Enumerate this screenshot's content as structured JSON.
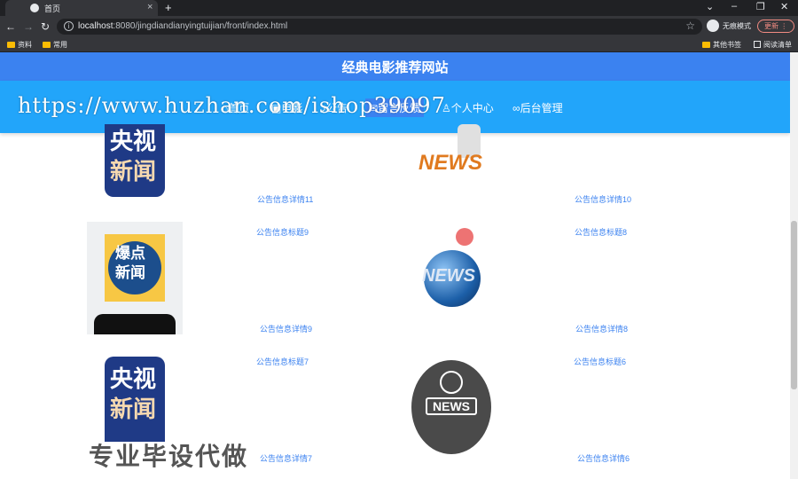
{
  "browser": {
    "tab_title": "首页",
    "new_tab": "+",
    "window_controls": {
      "minimize": "–",
      "maximize": "❐",
      "close": "✕"
    },
    "url_host": "localhost",
    "url_path": ":8080/jingdiandianyingtuijian/front/index.html",
    "incognito_label": "无痕模式",
    "update_label": "更新",
    "bookmarks": [
      "资料",
      "常用"
    ],
    "other_bookmarks": "其他书签",
    "reading_list": "阅读清单"
  },
  "site": {
    "title": "经典电影推荐网站",
    "nav": [
      {
        "label": "首页"
      },
      {
        "label": "电影"
      },
      {
        "label": "公告"
      },
      {
        "label": "留言反馈"
      },
      {
        "label": "个人中心"
      },
      {
        "label": "后台管理"
      }
    ],
    "watermark_url": "https://www.huzhan.com/ishop39097"
  },
  "news": [
    {
      "title": "",
      "detail": "公告信息详情11",
      "image": "cctv-news"
    },
    {
      "title": "",
      "detail": "公告信息详情10",
      "image": "news-3d-figure"
    },
    {
      "title": "公告信息标题9",
      "detail": "公告信息详情9",
      "image": "breaking-news-phone"
    },
    {
      "title": "公告信息标题8",
      "detail": "公告信息详情8",
      "image": "news-globe"
    },
    {
      "title": "公告信息标题7",
      "detail": "公告信息详情7",
      "image": "cctv-news"
    },
    {
      "title": "公告信息标题6",
      "detail": "公告信息详情6",
      "image": "news-globe-icon"
    }
  ],
  "thumb_text": {
    "cctv_a": "央视",
    "cctv_b": "新闻",
    "breaking_a": "爆点",
    "breaking_b": "新闻",
    "news_en": "NEWS"
  },
  "bottom_watermark": "专业毕设代做"
}
